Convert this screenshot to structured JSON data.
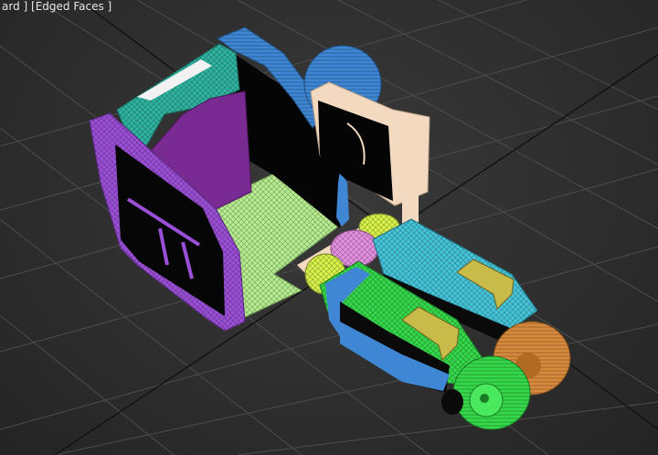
{
  "viewport": {
    "label_prefix": "ard ] ",
    "shading_mode": "[Edged Faces ]"
  },
  "colors": {
    "background": "#2d2d2d",
    "grid": "#4a4a4a",
    "grid_major": "#141414",
    "purple": "#9b4fd6",
    "teal": "#2fb3a0",
    "blue": "#3f86d4",
    "light_green": "#b6ec8f",
    "peach": "#f2d9bf",
    "green": "#35d84a",
    "cyan": "#45c4d8",
    "khaki": "#c9bb4a",
    "orange": "#d88a3c",
    "pink": "#e38fe0",
    "yellow_green": "#d8f24a"
  },
  "objects": [
    {
      "name": "cabin-frame",
      "icon": "purple-frame"
    },
    {
      "name": "cabin-teal-panel",
      "icon": "teal-panel"
    },
    {
      "name": "cabin-purple-panel",
      "icon": "purple-panel"
    },
    {
      "name": "cabin-blue-arch",
      "icon": "blue-arch"
    },
    {
      "name": "cabin-floor",
      "icon": "green-floor"
    },
    {
      "name": "blue-wheel",
      "icon": "wheel"
    },
    {
      "name": "peach-bracket",
      "icon": "bracket"
    },
    {
      "name": "pink-gear",
      "icon": "gear"
    },
    {
      "name": "lime-gear-left",
      "icon": "gear"
    },
    {
      "name": "lime-gear-top",
      "icon": "gear"
    },
    {
      "name": "green-track-arm",
      "icon": "arm"
    },
    {
      "name": "cyan-track-arm",
      "icon": "arm"
    },
    {
      "name": "green-wheel",
      "icon": "wheel"
    },
    {
      "name": "orange-wheel",
      "icon": "wheel"
    },
    {
      "name": "khaki-block-left",
      "icon": "block"
    },
    {
      "name": "khaki-block-right",
      "icon": "block"
    }
  ]
}
